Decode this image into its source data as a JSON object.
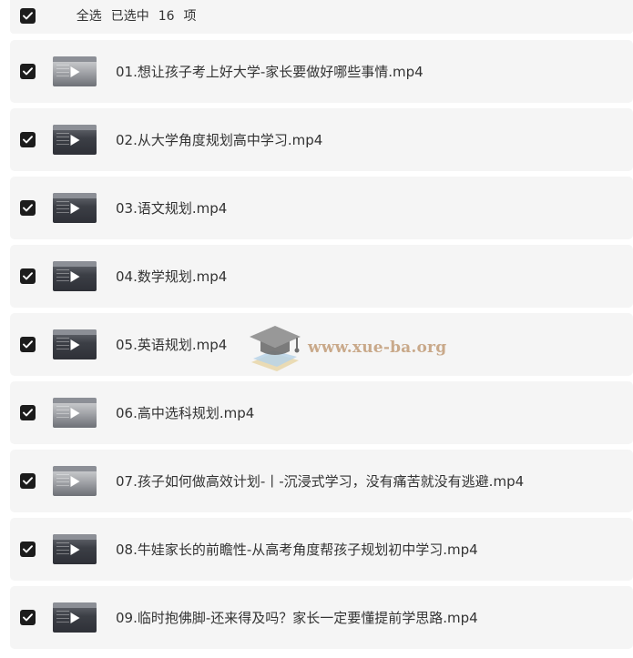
{
  "header": {
    "select_all_label": "全选",
    "selected_prefix": "已选中",
    "selected_count": "16",
    "selected_suffix": "项"
  },
  "files": [
    {
      "name": "01.想让孩子考上好大学-家长要做好哪些事情.mp4"
    },
    {
      "name": "02.从大学角度规划高中学习.mp4"
    },
    {
      "name": "03.语文规划.mp4"
    },
    {
      "name": "04.数学规划.mp4"
    },
    {
      "name": "05.英语规划.mp4"
    },
    {
      "name": "06.高中选科规划.mp4"
    },
    {
      "name": "07.孩子如何做高效计划-丨-沉浸式学习，没有痛苦就没有逃避.mp4"
    },
    {
      "name": "08.牛娃家长的前瞻性-从高考角度帮孩子规划初中学习.mp4"
    },
    {
      "name": "09.临时抱佛脚-还来得及吗？家长一定要懂提前学思路.mp4"
    }
  ],
  "watermark": {
    "text": "www.xue-ba.org"
  },
  "colors": {
    "checkbox": "#1c1c1c",
    "row_background": "#f5f5f5",
    "text": "#333333",
    "watermark": "#c9a98a"
  },
  "icons": {
    "checkbox": "checkbox-checked-icon",
    "play": "play-icon",
    "watermark_logo": "graduation-cap-icon"
  }
}
